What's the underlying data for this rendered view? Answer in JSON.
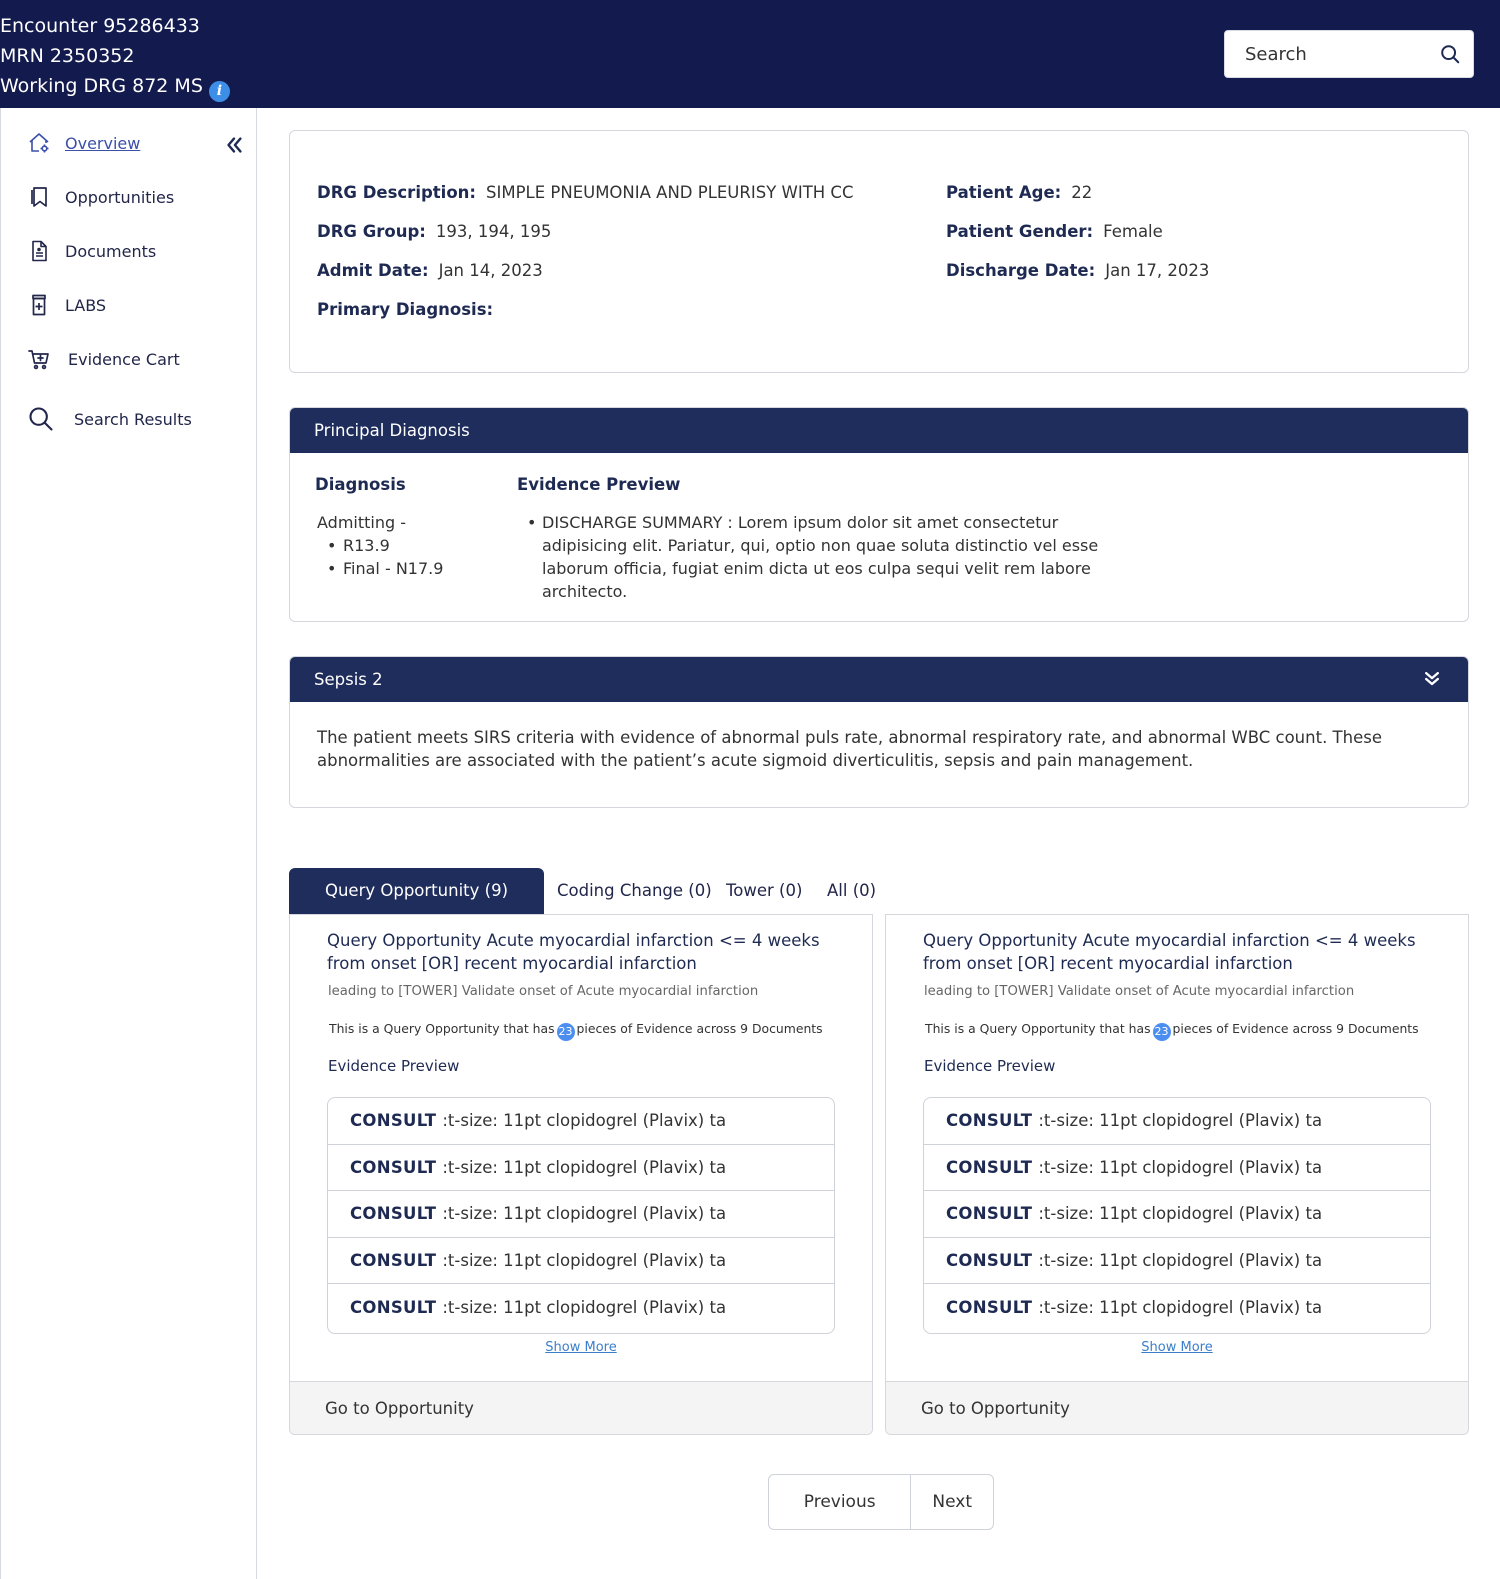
{
  "header": {
    "encounter": "Encounter 95286433",
    "mrn": "MRN 2350352",
    "working_drg": "Working DRG 872 MS",
    "info_icon": "info-icon",
    "search_placeholder": "Search",
    "search_icon": "search-icon",
    "bg_color": "#121a4e"
  },
  "sidebar": {
    "items": [
      {
        "label": "Overview",
        "icon": "home-gear-icon",
        "active": true
      },
      {
        "label": "Opportunities",
        "icon": "bookmark-icon"
      },
      {
        "label": "Documents",
        "icon": "document-icon"
      },
      {
        "label": "LABS",
        "icon": "lab-bottle-icon"
      },
      {
        "label": "Evidence Cart",
        "icon": "cart-icon"
      },
      {
        "label": "Search Results",
        "icon": "search-icon"
      }
    ],
    "collapse_icon": "double-chevron-left-icon"
  },
  "info": {
    "drg_description": {
      "key": "DRG Description:",
      "value": "SIMPLE PNEUMONIA AND PLEURISY WITH CC"
    },
    "drg_group": {
      "key": "DRG Group:",
      "value": "193, 194, 195"
    },
    "admit_date": {
      "key": "Admit Date:",
      "value": "Jan 14, 2023"
    },
    "primary_diagnosis": {
      "key": "Primary Diagnosis:",
      "value": ""
    },
    "patient_age": {
      "key": "Patient Age:",
      "value": "22"
    },
    "patient_gender": {
      "key": "Patient Gender:",
      "value": "Female"
    },
    "discharge_date": {
      "key": "Discharge Date:",
      "value": "Jan 17, 2023"
    }
  },
  "principal": {
    "title": "Principal Diagnosis",
    "diagnosis_header": "Diagnosis",
    "evidence_header": "Evidence Preview",
    "admitting": "Admitting -",
    "codes": [
      "R13.9",
      "Final - N17.9"
    ],
    "evidence": "DISCHARGE SUMMARY : Lorem ipsum dolor sit amet consectetur adipisicing elit. Pariatur, qui, optio non quae soluta distinctio vel esse laborum officia, fugiat enim dicta ut eos culpa sequi velit rem labore architecto."
  },
  "sepsis": {
    "title": "Sepsis 2",
    "icon": "double-chevron-down-icon",
    "text": "The patient meets SIRS criteria with evidence of abnormal puls rate, abnormal respiratory rate, and abnormal WBC count. These abnormalities are associated with the patient’s acute sigmoid diverticulitis, sepsis and pain management."
  },
  "tabs": [
    {
      "label": "Query Opportunity (9)",
      "active": true
    },
    {
      "label": "Coding Change (0)"
    },
    {
      "label": "Tower (0)"
    },
    {
      "label": "All (0)"
    }
  ],
  "opportunities": [
    {
      "title": "Query Opportunity Acute myocardial infarction <= 4 weeks from onset [OR] recent myocardial infarction",
      "subtitle": "leading to [TOWER] Validate onset of Acute myocardial infarction",
      "count_prefix": "This is a Query Opportunity that has",
      "count": "23",
      "count_suffix": "pieces of Evidence across 9 Documents",
      "evidence_title": "Evidence Preview",
      "evidence": [
        {
          "label": "CONSULT",
          "text": ":t-size: 11pt clopidogrel (Plavix) ta"
        },
        {
          "label": "CONSULT",
          "text": ":t-size: 11pt clopidogrel (Plavix) ta"
        },
        {
          "label": "CONSULT",
          "text": ":t-size: 11pt clopidogrel (Plavix) ta"
        },
        {
          "label": "CONSULT",
          "text": ":t-size: 11pt clopidogrel (Plavix) ta"
        },
        {
          "label": "CONSULT",
          "text": ":t-size: 11pt clopidogrel (Plavix) ta"
        }
      ],
      "show_more": "Show More",
      "go": "Go to Opportunity"
    },
    {
      "title": "Query Opportunity Acute myocardial infarction <= 4 weeks from onset [OR] recent myocardial infarction",
      "subtitle": "leading to [TOWER] Validate onset of Acute myocardial infarction",
      "count_prefix": "This is a Query Opportunity that has",
      "count": "23",
      "count_suffix": "pieces of Evidence across 9 Documents",
      "evidence_title": "Evidence Preview",
      "evidence": [
        {
          "label": "CONSULT",
          "text": ":t-size: 11pt clopidogrel (Plavix) ta"
        },
        {
          "label": "CONSULT",
          "text": ":t-size: 11pt clopidogrel (Plavix) ta"
        },
        {
          "label": "CONSULT",
          "text": ":t-size: 11pt clopidogrel (Plavix) ta"
        },
        {
          "label": "CONSULT",
          "text": ":t-size: 11pt clopidogrel (Plavix) ta"
        },
        {
          "label": "CONSULT",
          "text": ":t-size: 11pt clopidogrel (Plavix) ta"
        }
      ],
      "show_more": "Show More",
      "go": "Go to Opportunity"
    }
  ],
  "pager": {
    "previous": "Previous",
    "next": "Next"
  }
}
